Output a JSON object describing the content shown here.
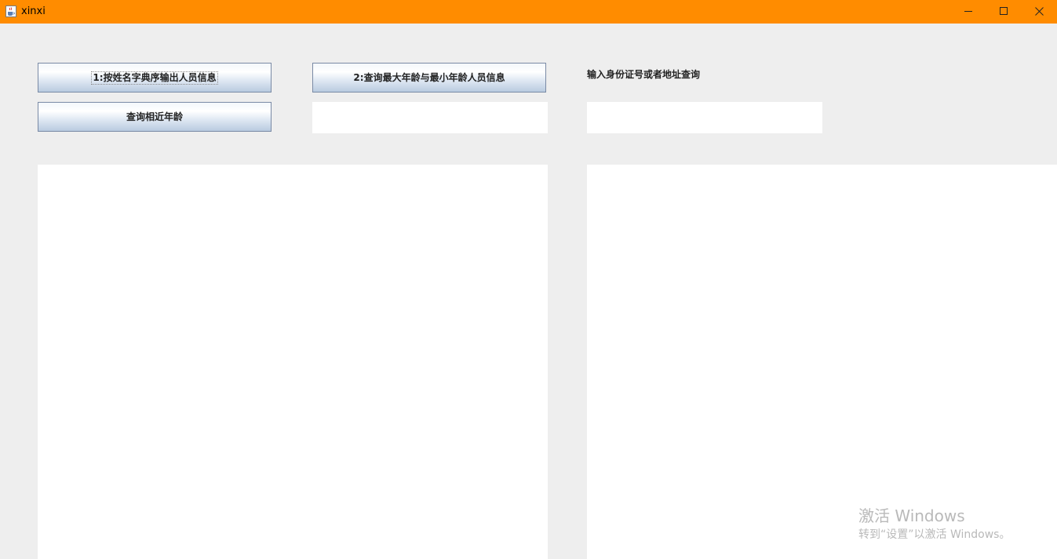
{
  "window": {
    "title": "xinxi",
    "titlebar_color": "#ff8c00",
    "controls": {
      "minimize": "minimize-icon",
      "maximize": "maximize-icon",
      "close": "close-icon"
    }
  },
  "buttons": {
    "sort_by_name": "1:按姓名字典序输出人员信息",
    "max_min_age": "2:查询最大年龄与最小年龄人员信息",
    "similar_age": "查询相近年龄"
  },
  "labels": {
    "search_prompt": "输入身份证号或者地址查询"
  },
  "inputs": {
    "age_value": "",
    "search_value": ""
  },
  "output": {
    "left_text": "",
    "right_text": ""
  },
  "watermark": {
    "title": "激活 Windows",
    "subtitle": "转到“设置”以激活 Windows。"
  }
}
